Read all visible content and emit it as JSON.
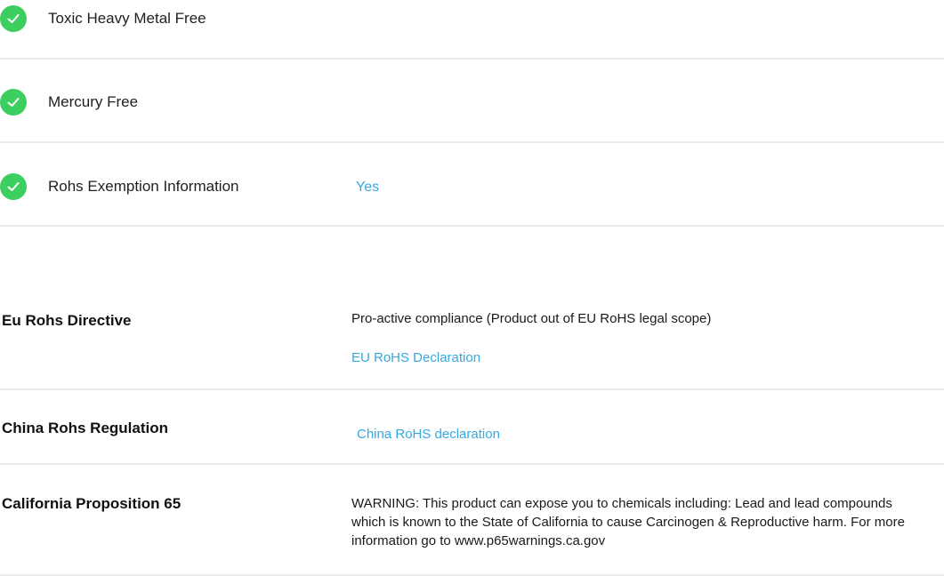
{
  "features": [
    {
      "label": "Toxic Heavy Metal Free",
      "icon": "check-circle-icon"
    },
    {
      "label": "Mercury Free",
      "icon": "check-circle-icon"
    },
    {
      "label": "Rohs Exemption Information",
      "value": "Yes",
      "icon": "check-circle-icon"
    }
  ],
  "regulations": {
    "eu": {
      "label": "Eu Rohs Directive",
      "value": "Pro-active compliance (Product out of EU RoHS legal scope)",
      "link": "EU RoHS Declaration"
    },
    "china": {
      "label": "China Rohs Regulation",
      "link": "China RoHS declaration"
    },
    "california": {
      "label": "California Proposition 65",
      "value": "WARNING: This product can expose you to chemicals including: Lead and lead compounds which is known to the State of California to cause Carcinogen & Reproductive harm. For more information go to www.p65warnings.ca.gov"
    }
  },
  "colors": {
    "check": "#3ccf5f",
    "link": "#35a8e0",
    "divider": "#ebebeb"
  }
}
